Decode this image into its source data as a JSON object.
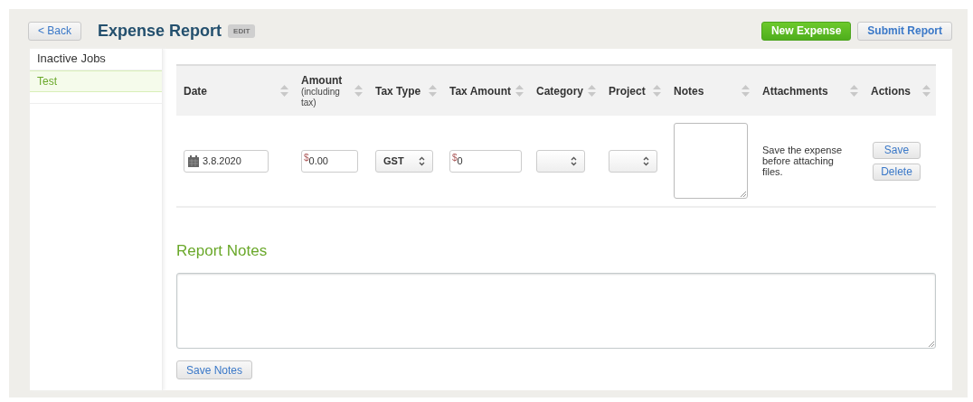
{
  "header": {
    "back_button": "< Back",
    "title": "Expense Report",
    "edit_badge": "EDIT",
    "buttons": [
      {
        "label": "New Expense",
        "kind": "primary"
      },
      {
        "label": "Submit Report",
        "kind": "secondary"
      }
    ]
  },
  "sidebar": {
    "items": [
      {
        "label": "Inactive Jobs",
        "selected": false
      },
      {
        "label": "Test",
        "selected": true
      }
    ]
  },
  "table": {
    "columns": [
      {
        "label": "Date"
      },
      {
        "label": "Amount",
        "sublabel": "(including tax)"
      },
      {
        "label": "Tax Type"
      },
      {
        "label": "Tax Amount"
      },
      {
        "label": "Category"
      },
      {
        "label": "Project"
      },
      {
        "label": "Notes"
      },
      {
        "label": "Attachments"
      },
      {
        "label": "Actions"
      }
    ],
    "rows": [
      {
        "cells": [
          {
            "kind": "date",
            "value": "3.8.2020"
          },
          {
            "kind": "money",
            "prefix": "$",
            "value": "0.00"
          },
          {
            "kind": "select",
            "value": "GST"
          },
          {
            "kind": "money",
            "prefix": "$",
            "value": "0"
          },
          {
            "kind": "select"
          },
          {
            "kind": "select"
          },
          {
            "kind": "textarea"
          },
          {
            "kind": "text",
            "text": "Save the expense before attaching files."
          },
          {
            "kind": "actions",
            "buttons": [
              "Save",
              "Delete"
            ]
          }
        ]
      }
    ]
  },
  "report_notes": {
    "title": "Report Notes",
    "button": "Save Notes"
  }
}
